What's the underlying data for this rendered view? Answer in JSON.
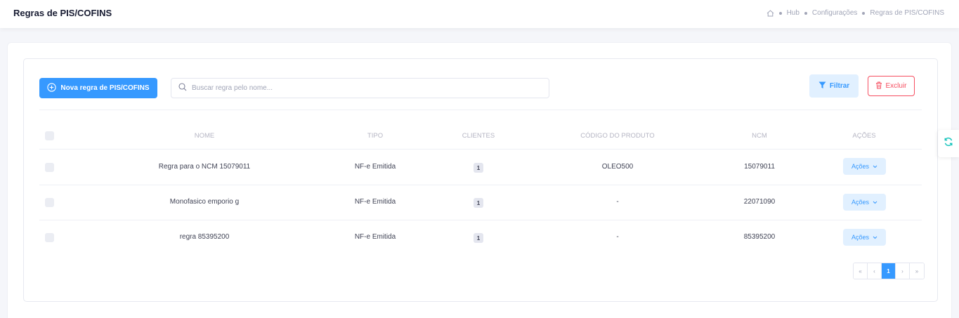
{
  "header": {
    "title": "Regras de PIS/COFINS",
    "breadcrumb": [
      "Hub",
      "Configurações",
      "Regras de PIS/COFINS"
    ]
  },
  "toolbar": {
    "new_button": "Nova regra de PIS/COFINS",
    "search_placeholder": "Buscar regra pelo nome...",
    "filter_button": "Filtrar",
    "delete_button": "Excluir"
  },
  "table": {
    "columns": [
      "NOME",
      "TIPO",
      "CLIENTES",
      "CÓDIGO DO PRODUTO",
      "NCM",
      "AÇÕES"
    ],
    "rows": [
      {
        "nome": "Regra para o NCM 15079011",
        "tipo": "NF-e Emitida",
        "clientes": "1",
        "codigo": "OLEO500",
        "ncm": "15079011",
        "acoes": "Ações"
      },
      {
        "nome": "Monofasico emporio g",
        "tipo": "NF-e Emitida",
        "clientes": "1",
        "codigo": "-",
        "ncm": "22071090",
        "acoes": "Ações"
      },
      {
        "nome": "regra 85395200",
        "tipo": "NF-e Emitida",
        "clientes": "1",
        "codigo": "-",
        "ncm": "85395200",
        "acoes": "Ações"
      }
    ]
  },
  "pagination": {
    "first": "«",
    "prev": "‹",
    "current": "1",
    "next": "›",
    "last": "»"
  },
  "colors": {
    "primary": "#3699ff",
    "primary_light": "#e1f0ff",
    "danger": "#f64e60",
    "refresh": "#1bc5bd"
  },
  "icons": {
    "home": "home-icon",
    "add": "plus-circle-icon",
    "search": "search-icon",
    "filter": "filter-icon",
    "delete": "trash-icon",
    "dropdown": "chevron-down-icon",
    "refresh": "refresh-icon"
  }
}
